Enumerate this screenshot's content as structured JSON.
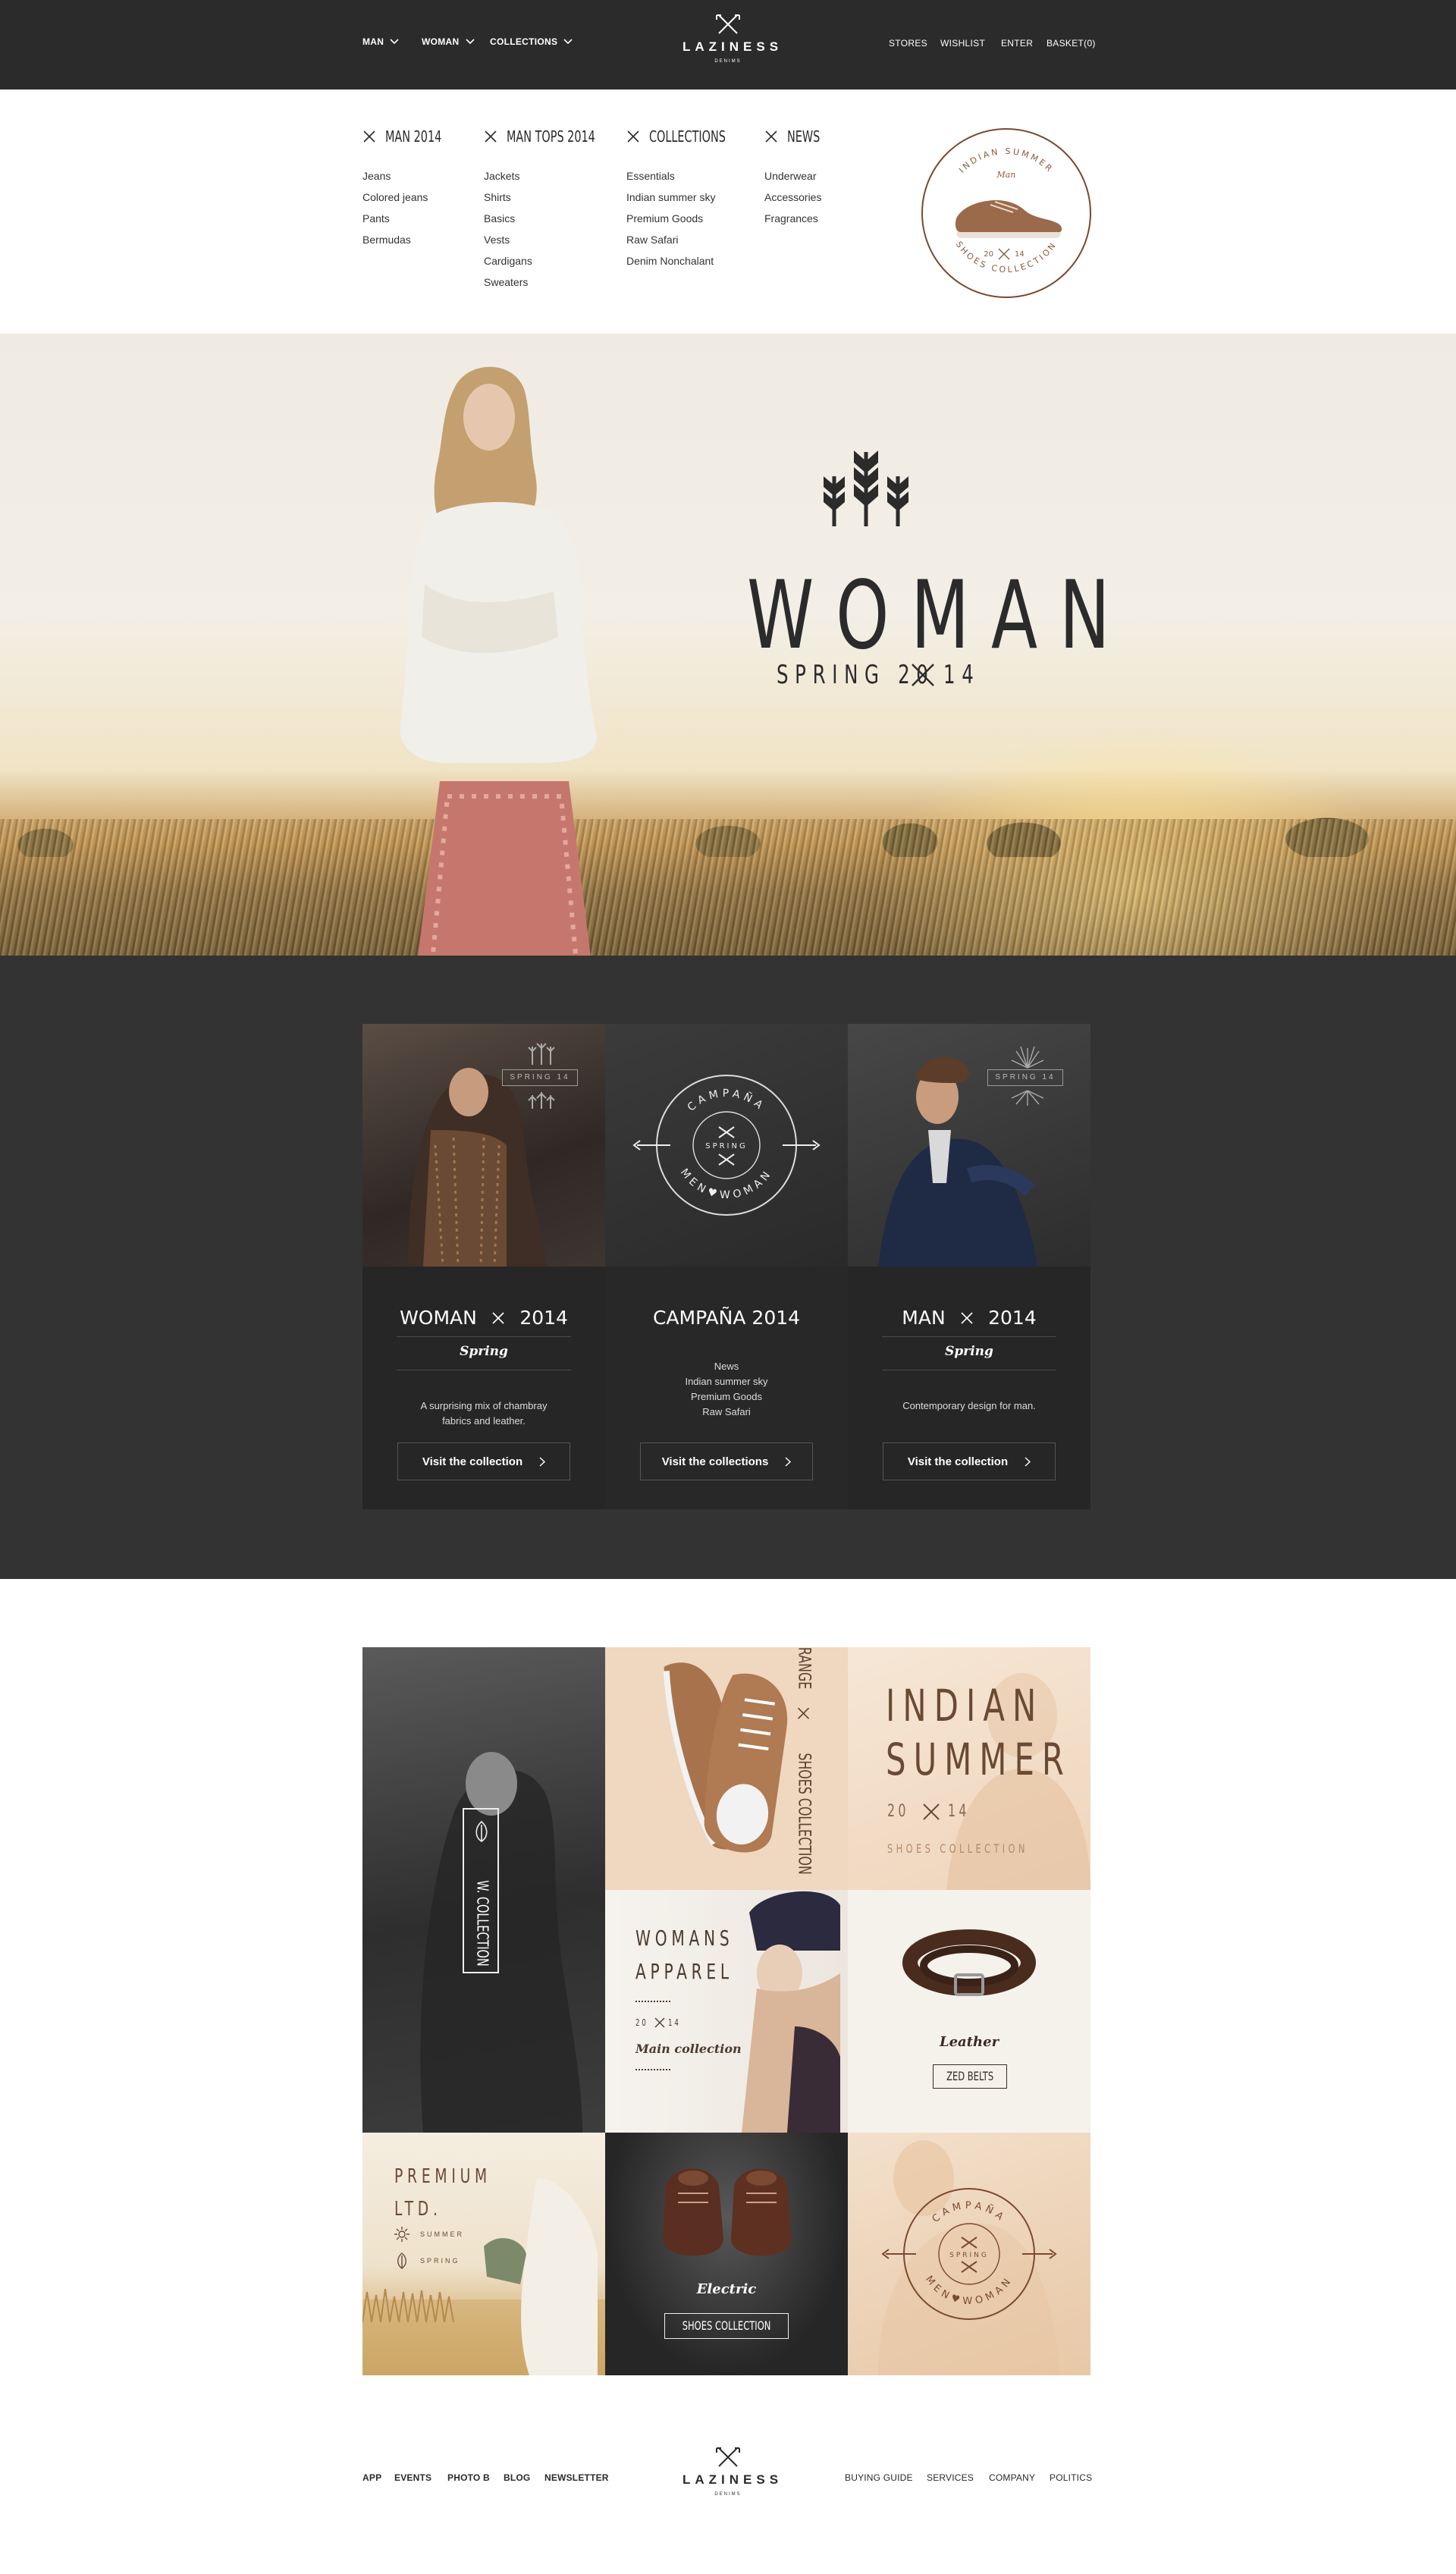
{
  "header": {
    "nav_left": [
      "MAN",
      "WOMAN",
      "COLLECTIONS"
    ],
    "logo": "LAZINESS",
    "logo_sub": "DENIMS",
    "nav_right": [
      "STORES",
      "WISHLIST",
      "ENTER",
      "BASKET(0)"
    ]
  },
  "mega_menu": {
    "columns": [
      {
        "title": "MAN 2014",
        "items": [
          "Jeans",
          "Colored jeans",
          "Pants",
          "Bermudas"
        ]
      },
      {
        "title": "MAN TOPS 2014",
        "items": [
          "Jackets",
          "Shirts",
          "Basics",
          "Vests",
          "Cardigans",
          "Sweaters"
        ]
      },
      {
        "title": "COLLECTIONS",
        "items": [
          "Essentials",
          "Indian summer sky",
          "Premium Goods",
          "Raw Safari",
          "Denim Nonchalant"
        ]
      },
      {
        "title": "NEWS",
        "items": [
          "Underwear",
          "Accessories",
          "Fragrances"
        ]
      }
    ],
    "badge": {
      "top": "INDIAN SUMMER",
      "script": "Man",
      "year_left": "20",
      "year_right": "14",
      "bottom": "SHOES COLLECTION"
    }
  },
  "hero": {
    "title": "WOMAN",
    "subtitle_left": "SPRING 20",
    "subtitle_right": "14"
  },
  "collections": [
    {
      "title_left": "WOMAN",
      "title_right": "2014",
      "script": "Spring",
      "desc": "A surprising mix of chambray fabrics and leather.",
      "button": "Visit the collection",
      "badge": "SPRING 14"
    },
    {
      "title_left": "CAMPAÑA 2014",
      "title_right": "",
      "script": "",
      "desc_lines": [
        "News",
        "Indian summer sky",
        "Premium Goods",
        "Raw Safari"
      ],
      "button": "Visit the collections",
      "badge_top": "CAMPAÑA",
      "badge_mid": "SPRING",
      "badge_bottom": "MEN♥WOMAN"
    },
    {
      "title_left": "MAN",
      "title_right": "2014",
      "script": "Spring",
      "desc": "Contemporary design for man.",
      "button": "Visit the collection",
      "badge": "SPRING 14"
    }
  ],
  "grid": {
    "w_collection": "W. COLLECTION",
    "range_text": "RANGE",
    "shoes_collection_vertical": "SHOES COLLECTION",
    "indian_1": "INDIAN",
    "indian_2": "SUMMER",
    "indian_year_left": "20",
    "indian_year_right": "14",
    "indian_sub": "SHOES COLLECTION",
    "womans_1": "WOMANS",
    "womans_2": "APPAREL",
    "womans_year_left": "20",
    "womans_year_right": "14",
    "womans_script": "Main collection",
    "leather_script": "Leather",
    "leather_button": "ZED BELTS",
    "premium_1": "PREMIUM",
    "premium_2": "LTD.",
    "premium_summer": "SUMMER",
    "premium_spring": "SPRING",
    "electric_script": "Electric",
    "electric_button": "SHOES COLLECTION",
    "campana_top": "CAMPAÑA",
    "campana_mid": "SPRING",
    "campana_bottom": "MEN♥WOMAN"
  },
  "footer": {
    "links_left": [
      "APP",
      "EVENTS",
      "PHOTO B",
      "BLOG",
      "NEWSLETTER"
    ],
    "logo": "LAZINESS",
    "logo_sub": "DENIMS",
    "links_right": [
      "BUYING GUIDE",
      "SERVICES",
      "COMPANY",
      "POLITICS"
    ]
  },
  "colors": {
    "dark": "#2b2b2b",
    "panel": "#333333",
    "card": "#262626",
    "tan": "#efd9c3",
    "brown": "#6b3e26"
  }
}
